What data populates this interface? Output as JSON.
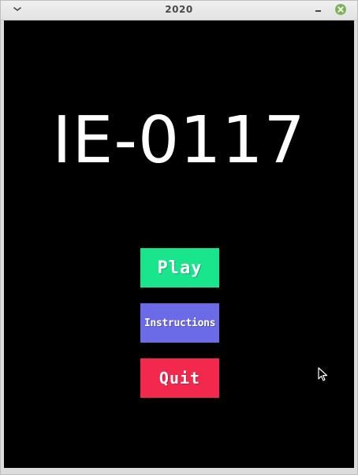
{
  "window": {
    "title": "2020"
  },
  "game": {
    "title": "IE-0117",
    "buttons": [
      {
        "label": "Play",
        "color": "#19e68c"
      },
      {
        "label": "Instructions",
        "color": "#6b6be8"
      },
      {
        "label": "Quit",
        "color": "#f2294d"
      }
    ]
  },
  "icons": {
    "menu": "chevron-down-icon",
    "minimize": "minimize-icon",
    "close": "close-icon",
    "cursor": "mouse-pointer-icon"
  },
  "colors": {
    "background": "#000000",
    "title_text": "#ffffff",
    "close_button": "#6aa84f"
  }
}
